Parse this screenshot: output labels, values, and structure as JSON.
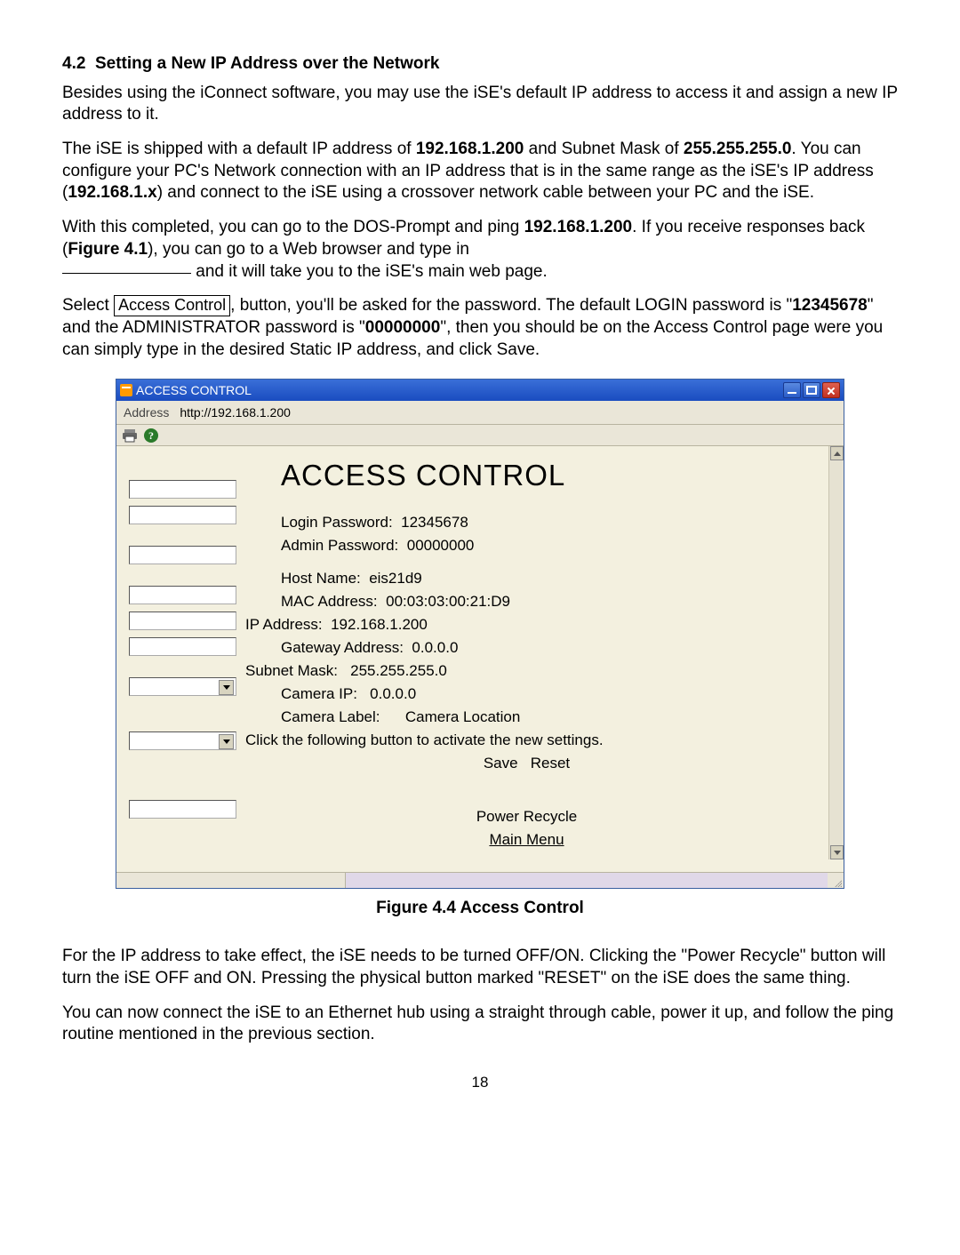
{
  "section": {
    "number": "4.2",
    "title": "Setting a New IP Address over the Network"
  },
  "para1_a": "Besides using the iConnect software, you may use the iSE's default IP address to access it and assign a new IP address to it.",
  "para2_a": "The iSE is shipped with a default IP address of ",
  "para2_ip": "192.168.1.200",
  "para2_b": " and Subnet Mask of ",
  "para2_mask": "255.255.255.0",
  "para2_c": ".  You can configure your PC's Network connection with an IP address that is in the same range as the iSE's IP address (",
  "para2_range": "192.168.1.x",
  "para2_d": ") and connect to the iSE using a crossover network cable between your PC and the iSE.",
  "para3_a": "With this completed, you can go to the DOS-Prompt and ping ",
  "para3_ip": "192.168.1.200",
  "para3_b": ". If you receive responses back (",
  "para3_fig": "Figure 4.1",
  "para3_c": "), you can go to a Web browser and type in ",
  "para3_d": " and it will take you to the iSE's main web page.",
  "para4_a": "Select ",
  "para4_btn": "Access Control",
  "para4_b": ", button, you'll be asked for the password. The default LOGIN password is \"",
  "para4_login": "12345678",
  "para4_c": "\" and the ADMINISTRATOR password is \"",
  "para4_admin": "00000000",
  "para4_d": "\", then you should be on the Access Control page were you can simply type in the desired Static IP address, and click Save.",
  "window": {
    "title": "ACCESS CONTROL",
    "addressLabel": "Address",
    "addressValue": "http://192.168.1.200",
    "pageTitle": "ACCESS CONTROL",
    "fields": {
      "loginPwLabel": "Login Password:",
      "loginPwVal": "12345678",
      "adminPwLabel": "Admin Password:",
      "adminPwVal": "00000000",
      "hostLabel": "Host Name:",
      "hostVal": "eis21d9",
      "macLabel": "MAC Address:",
      "macVal": "00:03:03:00:21:D9",
      "ipLabel": "IP Address:",
      "ipVal": "192.168.1.200",
      "gwLabel": "Gateway Address:",
      "gwVal": "0.0.0.0",
      "maskLabel": "Subnet Mask:",
      "maskVal": "255.255.255.0",
      "camIpLabel": "Camera IP:",
      "camIpVal": "0.0.0.0",
      "camLblLabel": "Camera Label:",
      "camLblVal": "Camera Location",
      "instruction": "Click the following button to activate the new settings.",
      "saveBtn": "Save",
      "resetBtn": "Reset",
      "powerBtn": "Power Recycle",
      "mainMenu": "Main Menu"
    }
  },
  "figureCaption": "Figure 4.4  Access Control",
  "para5": "For the IP address to take effect, the iSE needs to be turned OFF/ON. Clicking the \"Power Recycle\" button will turn the iSE OFF and ON. Pressing the physical button marked \"RESET\" on the iSE does the same thing.",
  "para6": "You can now connect the iSE to an Ethernet hub using a straight through cable, power it up, and follow the ping routine mentioned in the previous section.",
  "pageNumber": "18"
}
